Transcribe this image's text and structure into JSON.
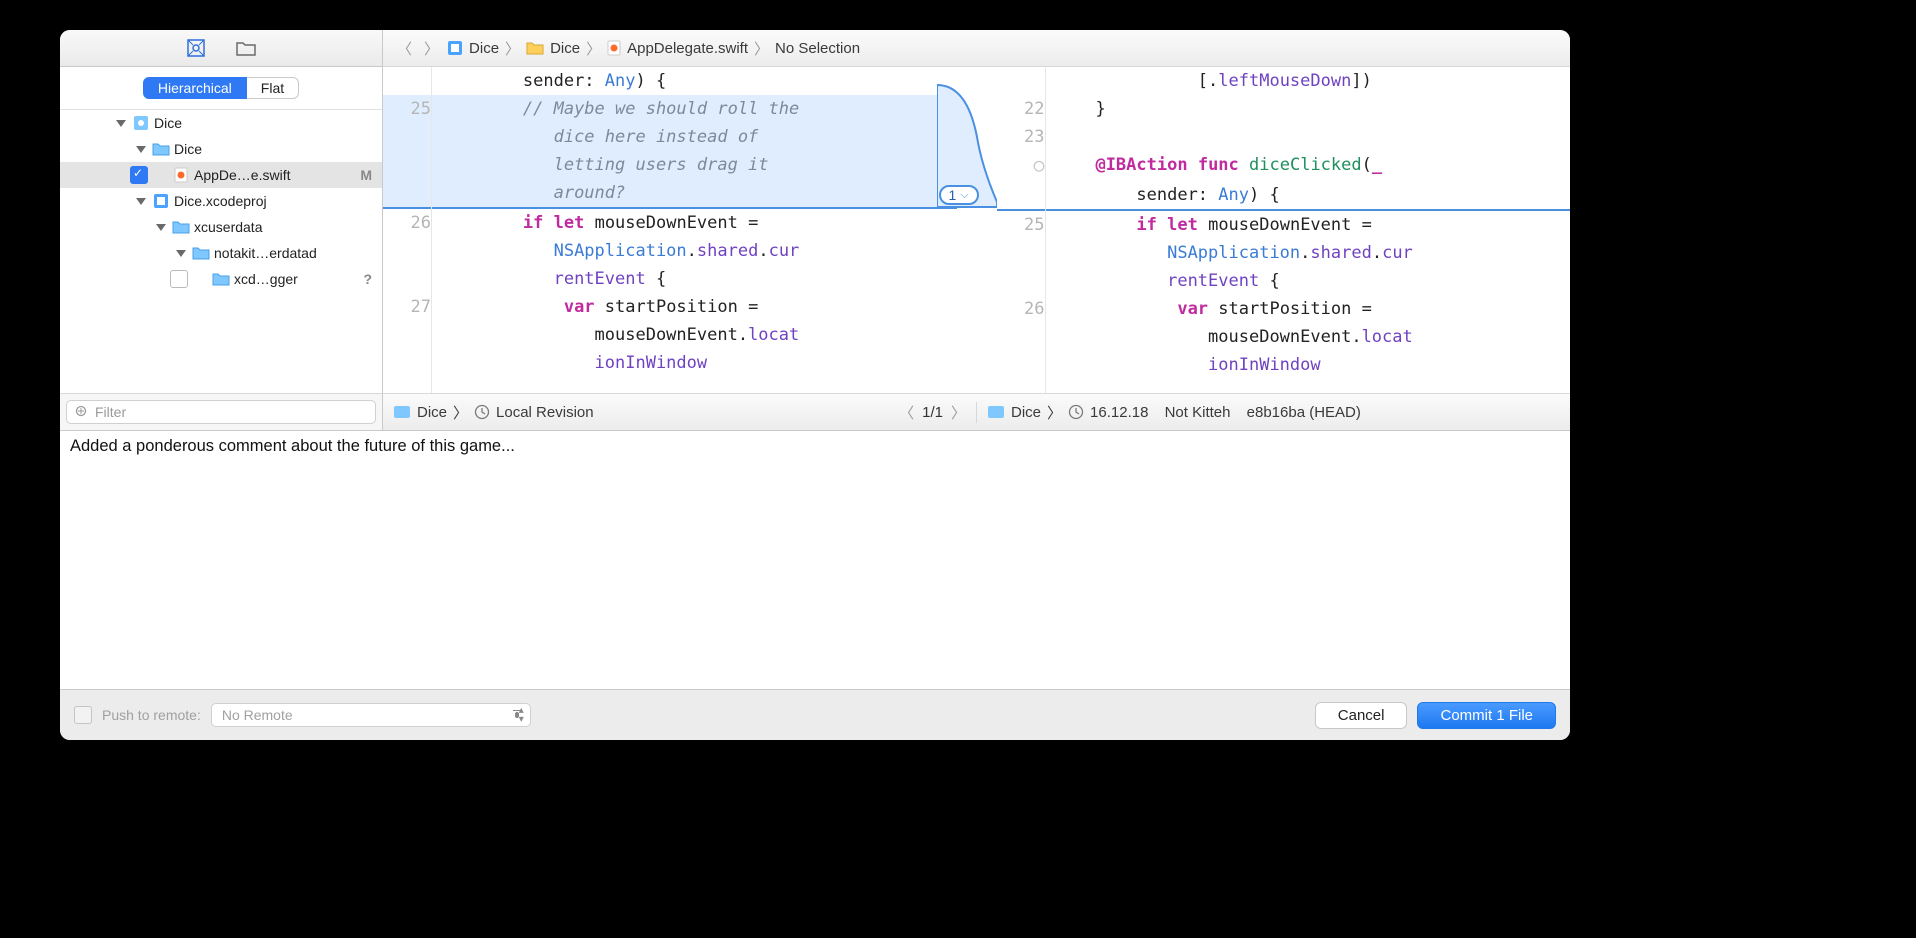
{
  "sidebar": {
    "tabs": {
      "hierarchical": "Hierarchical",
      "flat": "Flat"
    },
    "filter_placeholder": "Filter",
    "tree": [
      {
        "indent": 1,
        "disc": true,
        "icon": "project",
        "label": "Dice",
        "chk": false,
        "status": ""
      },
      {
        "indent": 2,
        "disc": true,
        "icon": "folder",
        "label": "Dice",
        "chk": false,
        "status": ""
      },
      {
        "indent": 3,
        "disc": false,
        "icon": "swift",
        "label": "AppDe…e.swift",
        "chk": true,
        "checked": true,
        "status": "M",
        "selected": true
      },
      {
        "indent": 2,
        "disc": true,
        "icon": "xcodeproj",
        "label": "Dice.xcodeproj",
        "chk": false,
        "status": ""
      },
      {
        "indent": 3,
        "disc": true,
        "icon": "folder",
        "label": "xcuserdata",
        "chk": false,
        "status": ""
      },
      {
        "indent": 4,
        "disc": true,
        "icon": "folder",
        "label": "notakit…erdatad",
        "chk": false,
        "status": ""
      },
      {
        "indent": 5,
        "disc": false,
        "icon": "folder",
        "label": "xcd…gger",
        "chk": true,
        "checked": false,
        "status": "?"
      }
    ]
  },
  "jumpbar": {
    "project": "Dice",
    "folder": "Dice",
    "file": "AppDelegate.swift",
    "selection": "No Selection"
  },
  "diff": {
    "change_pill": "1",
    "left": [
      {
        "ln": "",
        "html": "        sender: <span class='type'>Any</span>) {"
      },
      {
        "ln": "25",
        "hl": true,
        "html": "<span class='cmt'>        // Maybe we should roll the</span>"
      },
      {
        "ln": "",
        "hl": true,
        "html": "<span class='cmt'>           dice here instead of</span>"
      },
      {
        "ln": "",
        "hl": true,
        "html": "<span class='cmt'>           letting users drag it</span>"
      },
      {
        "ln": "",
        "hl": true,
        "hlbot": true,
        "html": "<span class='cmt'>           around?</span>"
      },
      {
        "ln": "26",
        "html": "        <span class='kw'>if</span> <span class='kw'>let</span> mouseDownEvent = "
      },
      {
        "ln": "",
        "html": "           <span class='type'>NSApplication</span>.<span class='prop'>shared</span>.<span class='prop'>cur</span>"
      },
      {
        "ln": "",
        "html": "           <span class='prop'>rentEvent</span> {"
      },
      {
        "ln": "27",
        "html": "            <span class='kw'>var</span> startPosition = "
      },
      {
        "ln": "",
        "html": "               mouseDownEvent.<span class='prop'>locat</span>"
      },
      {
        "ln": "",
        "html": "               <span class='prop'>ionInWindow</span>"
      }
    ],
    "right": [
      {
        "ln": "",
        "html": "              [.<span class='prop'>leftMouseDown</span>])"
      },
      {
        "ln": "22",
        "html": "    }"
      },
      {
        "ln": "23",
        "html": " "
      },
      {
        "ln": "○",
        "circle": true,
        "html": "    <span class='attr'>@IBAction</span> <span class='kw'>func</span> <span class='func'>diceClicked</span>(<span class='kw'>_</span>"
      },
      {
        "ln": "",
        "hlbot": true,
        "html": "        sender: <span class='type'>Any</span>) {"
      },
      {
        "ln": "25",
        "html": "        <span class='kw'>if</span> <span class='kw'>let</span> mouseDownEvent = "
      },
      {
        "ln": "",
        "html": "           <span class='type'>NSApplication</span>.<span class='prop'>shared</span>.<span class='prop'>cur</span>"
      },
      {
        "ln": "",
        "html": "           <span class='prop'>rentEvent</span> {"
      },
      {
        "ln": "26",
        "html": "            <span class='kw'>var</span> startPosition = "
      },
      {
        "ln": "",
        "html": "               mouseDownEvent.<span class='prop'>locat</span>"
      },
      {
        "ln": "",
        "html": "               <span class='prop'>ionInWindow</span>"
      }
    ]
  },
  "footbar": {
    "left_project": "Dice",
    "left_rev": "Local Revision",
    "nav_count": "1/1",
    "right_project": "Dice",
    "right_date": "16.12.18",
    "right_author": "Not Kitteh",
    "right_hash": "e8b16ba (HEAD)"
  },
  "commit_message": "Added a ponderous comment about the future of this game...",
  "bottom": {
    "push_label": "Push to remote:",
    "remote_value": "No Remote",
    "cancel": "Cancel",
    "commit": "Commit 1 File"
  }
}
